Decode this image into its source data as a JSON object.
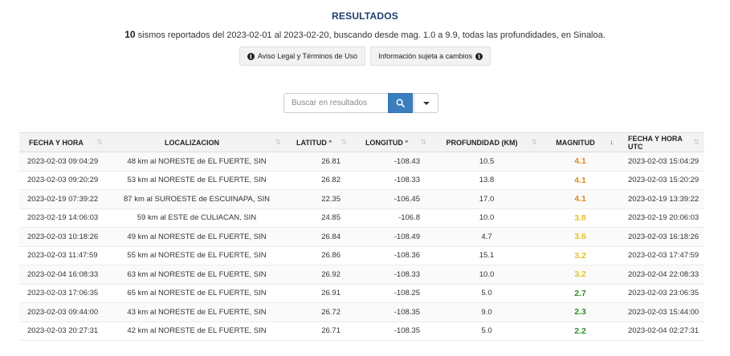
{
  "title": "RESULTADOS",
  "summary": {
    "count": "10",
    "text": "sismos reportados del 2023-02-01 al 2023-02-20, buscando desde mag. 1.0 a 9.9, todas las profundidades, en Sinaloa."
  },
  "buttons": {
    "legal": "Aviso Legal y Términos de Uso",
    "info": "Información sujeta a cambios"
  },
  "search": {
    "placeholder": "Buscar en resultados"
  },
  "colors": {
    "mag_orange": "#e08a1e",
    "mag_yellow": "#e3c22a",
    "mag_green": "#2e8b2e",
    "search_blue": "#3a7ebf"
  },
  "table": {
    "headers": [
      "FECHA Y HORA",
      "LOCALIZACION",
      "LATITUD °",
      "LONGITUD °",
      "PROFUNDIDAD (KM)",
      "MAGNITUD",
      "FECHA Y HORA UTC"
    ],
    "rows": [
      {
        "fecha": "2023-02-03  09:04:29",
        "loc": "48 km al NORESTE de EL FUERTE, SIN",
        "lat": "26.81",
        "lon": "-108.43",
        "prof": "10.5",
        "mag": "4.1",
        "level": "orange",
        "utc": "2023-02-03  15:04:29"
      },
      {
        "fecha": "2023-02-03  09:20:29",
        "loc": "53 km al NORESTE de EL FUERTE, SIN",
        "lat": "26.82",
        "lon": "-108.33",
        "prof": "13.8",
        "mag": "4.1",
        "level": "orange",
        "utc": "2023-02-03  15:20:29"
      },
      {
        "fecha": "2023-02-19  07:39:22",
        "loc": "87 km al SUROESTE de ESCUINAPA, SIN",
        "lat": "22.35",
        "lon": "-106.45",
        "prof": "17.0",
        "mag": "4.1",
        "level": "orange",
        "utc": "2023-02-19  13:39:22"
      },
      {
        "fecha": "2023-02-19  14:06:03",
        "loc": "59 km al ESTE de CULIACAN, SIN",
        "lat": "24.85",
        "lon": "-106.8",
        "prof": "10.0",
        "mag": "3.8",
        "level": "yellow",
        "utc": "2023-02-19  20:06:03"
      },
      {
        "fecha": "2023-02-03  10:18:26",
        "loc": "49 km al NORESTE de EL FUERTE, SIN",
        "lat": "26.84",
        "lon": "-108.49",
        "prof": "4.7",
        "mag": "3.6",
        "level": "yellow",
        "utc": "2023-02-03  16:18:26"
      },
      {
        "fecha": "2023-02-03  11:47:59",
        "loc": "55 km al NORESTE de EL FUERTE, SIN",
        "lat": "26.86",
        "lon": "-108.36",
        "prof": "15.1",
        "mag": "3.2",
        "level": "yellow",
        "utc": "2023-02-03  17:47:59"
      },
      {
        "fecha": "2023-02-04  16:08:33",
        "loc": "63 km al NORESTE de EL FUERTE, SIN",
        "lat": "26.92",
        "lon": "-108.33",
        "prof": "10.0",
        "mag": "3.2",
        "level": "yellow",
        "utc": "2023-02-04  22:08:33"
      },
      {
        "fecha": "2023-02-03  17:06:35",
        "loc": "65 km al NORESTE de EL FUERTE, SIN",
        "lat": "26.91",
        "lon": "-108.25",
        "prof": "5.0",
        "mag": "2.7",
        "level": "green",
        "utc": "2023-02-03  23:06:35"
      },
      {
        "fecha": "2023-02-03  09:44:00",
        "loc": "43 km al NORESTE de EL FUERTE, SIN",
        "lat": "26.72",
        "lon": "-108.35",
        "prof": "9.0",
        "mag": "2.3",
        "level": "green",
        "utc": "2023-02-03  15:44:00"
      },
      {
        "fecha": "2023-02-03  20:27:31",
        "loc": "42 km al NORESTE de EL FUERTE, SIN",
        "lat": "26.71",
        "lon": "-108.35",
        "prof": "5.0",
        "mag": "2.2",
        "level": "green",
        "utc": "2023-02-04  02:27:31"
      }
    ]
  }
}
